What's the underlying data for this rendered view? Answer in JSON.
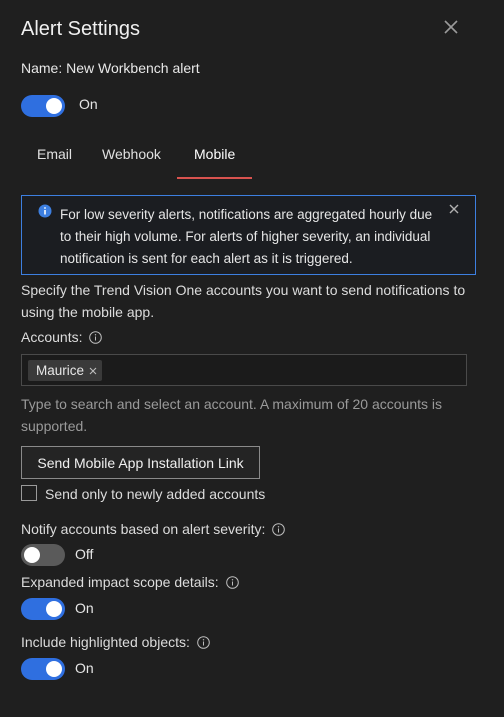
{
  "header": {
    "title": "Alert Settings",
    "close_icon": "close-icon"
  },
  "name_line": "Name: New Workbench alert",
  "main_toggle": {
    "state": "on",
    "label": "On"
  },
  "tabs": [
    {
      "label": "Email",
      "active": false
    },
    {
      "label": "Webhook",
      "active": false
    },
    {
      "label": "Mobile",
      "active": true
    }
  ],
  "info_banner": {
    "icon": "info-icon",
    "text": "For low severity alerts, notifications are aggregated hourly due to their high volume. For alerts of higher severity, an individual notification is sent for each alert as it is triggered."
  },
  "description": "Specify the Trend Vision One accounts you want to send notifications to using the mobile app.",
  "accounts": {
    "label": "Accounts:",
    "selected": [
      "Maurice"
    ],
    "hint": "Type to search and select an account. A maximum of 20 accounts is supported."
  },
  "install_button": "Send Mobile App Installation Link",
  "checkbox": {
    "label": "Send only to newly added accounts",
    "checked": false
  },
  "severity": {
    "label": "Notify accounts based on alert severity:",
    "state": "off",
    "toggle_label": "Off"
  },
  "impact": {
    "label": "Expanded impact scope details:",
    "state": "on",
    "toggle_label": "On"
  },
  "highlighted": {
    "label": "Include highlighted objects:",
    "state": "on",
    "toggle_label": "On"
  },
  "colors": {
    "background": "#1f1f1f",
    "toggle_on": "#2f6fe0",
    "toggle_off": "#5a5a5a",
    "tab_underline": "#d9534f",
    "info_border": "#3d7fe0"
  }
}
